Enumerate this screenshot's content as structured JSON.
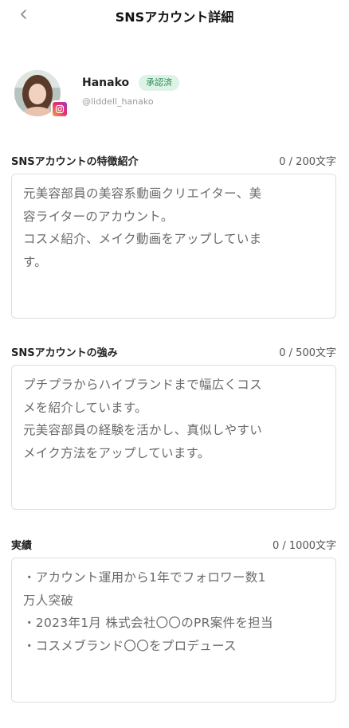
{
  "header": {
    "title": "SNSアカウント詳細",
    "back_icon": "chevron-left-icon"
  },
  "profile": {
    "name": "Hanako",
    "status_badge": "承認済",
    "handle": "@liddell_hanako",
    "platform_icon": "instagram-icon"
  },
  "sections": [
    {
      "label": "SNSアカウントの特徴紹介",
      "counter": "0 / 200文字",
      "text": "元美容部員の美容系動画クリエイター、美\n容ライターのアカウント。\nコスメ紹介、メイク動画をアップしていま\nす。"
    },
    {
      "label": "SNSアカウントの強み",
      "counter": "0 / 500文字",
      "text": "プチプラからハイブランドまで幅広くコス\nメを紹介しています。\n元美容部員の経験を活かし、真似しやすい\nメイク方法をアップしています。"
    },
    {
      "label": "実績",
      "counter": "0 / 1000文字",
      "text": "・アカウント運用から1年でフォロワー数1\n万人突破\n・2023年1月 株式会社〇〇のPR案件を担当\n・コスメブランド〇〇をプロデュース"
    }
  ],
  "colors": {
    "badge_bg": "#dcf3e6",
    "badge_text": "#2f8a5a",
    "border": "#dedede"
  }
}
